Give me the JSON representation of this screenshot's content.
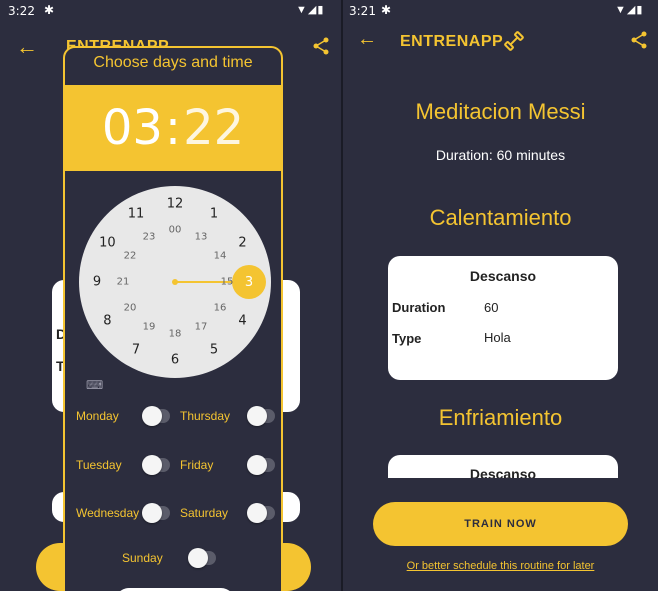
{
  "colors": {
    "accent": "#f4c431",
    "background": "#2c2d3e",
    "card": "#ffffff"
  },
  "left": {
    "status": {
      "time": "3:22"
    },
    "app_title": "ENTRENAPP",
    "background_labels": {
      "d": "D",
      "t": "T"
    },
    "dialog": {
      "title": "Choose days and time",
      "hour": "03",
      "separator": ":",
      "minute": "22",
      "clock_outer": [
        "12",
        "1",
        "2",
        "3",
        "4",
        "5",
        "6",
        "7",
        "8",
        "9",
        "10",
        "11"
      ],
      "clock_inner": [
        "00",
        "13",
        "14",
        "15",
        "16",
        "17",
        "18",
        "19",
        "20",
        "21",
        "22",
        "23"
      ],
      "selected": "3",
      "days": [
        {
          "label": "Monday",
          "on": false
        },
        {
          "label": "Thursday",
          "on": false
        },
        {
          "label": "Tuesday",
          "on": false
        },
        {
          "label": "Friday",
          "on": false
        },
        {
          "label": "Wednesday",
          "on": false
        },
        {
          "label": "Saturday",
          "on": false
        },
        {
          "label": "Sunday",
          "on": false
        }
      ],
      "keyboard_icon": "keyboard-icon"
    }
  },
  "right": {
    "status": {
      "time": "3:21"
    },
    "app_title": "ENTRENAPP",
    "routine_title": "Meditacion Messi",
    "duration": "Duration: 60 minutes",
    "sections": [
      {
        "title": "Calentamiento",
        "card": {
          "title": "Descanso",
          "rows": [
            {
              "key": "Duration",
              "value": "60"
            },
            {
              "key": "Type",
              "value": "Hola"
            }
          ]
        }
      },
      {
        "title": "Enfriamiento",
        "card": {
          "title": "Descanso"
        }
      }
    ],
    "train_button": "TRAIN NOW",
    "schedule_link": "Or better schedule this routine for later"
  }
}
